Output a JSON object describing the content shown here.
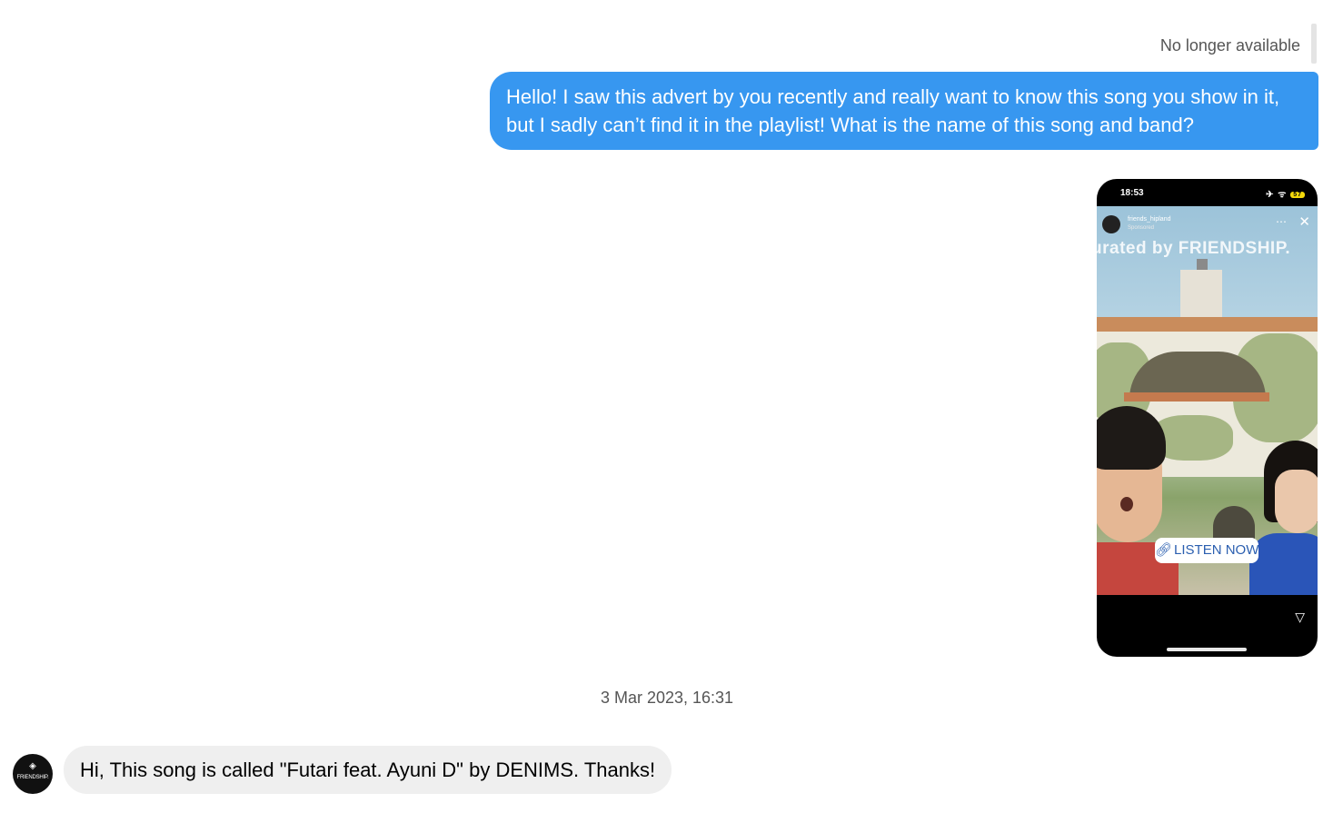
{
  "thread": {
    "status_label": "No longer available",
    "outgoing_message": "Hello! I saw this advert by you recently and really want to know this song you show in it, but I sadly can’t find it in the playlist! What is the name of this song and band?",
    "timestamp": "3 Mar 2023, 16:31",
    "incoming_message": "Hi, This song is called \"Futari feat. Ayuni D\" by DENIMS. Thanks!"
  },
  "story_screenshot": {
    "status_time": "18:53",
    "status_icons": "✈ ᯤ",
    "battery_level": "57",
    "username": "friends_hipland",
    "sponsored_label": "Sponsored",
    "overlay_text": "urated by FRIENDSHIP.",
    "cta_label": "LISTEN NOW",
    "icons": [
      "more-icon",
      "close-icon",
      "link-icon",
      "send-icon"
    ]
  },
  "sender": {
    "avatar_text": "FRIENDSHIP."
  },
  "colors": {
    "outgoing_bubble": "#3797f0",
    "incoming_bubble": "#efefef",
    "meta_text": "#555555"
  }
}
